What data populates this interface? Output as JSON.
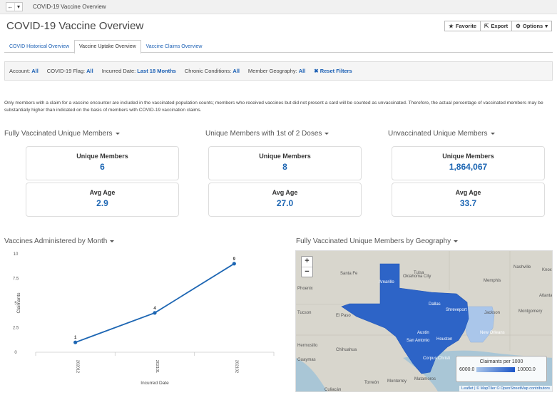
{
  "nav": {
    "back_glyph": "←",
    "menu_glyph": "▾",
    "breadcrumb": "COVID-19 Vaccine Overview"
  },
  "page": {
    "title": "COVID-19 Vaccine Overview"
  },
  "actions": {
    "favorite": {
      "icon": "star-icon",
      "glyph": "★",
      "label": "Favorite"
    },
    "export": {
      "icon": "export-icon",
      "glyph": "⇱",
      "label": "Export"
    },
    "options": {
      "icon": "gear-icon",
      "glyph": "⚙",
      "label": "Options",
      "caret": "▾"
    }
  },
  "tabs": [
    {
      "label": "COVID Historical Overview"
    },
    {
      "label": "Vaccine Uptake Overview"
    },
    {
      "label": "Vaccine Claims Overview"
    }
  ],
  "filters": {
    "items": [
      {
        "label": "Account:",
        "value": "All"
      },
      {
        "label": "COVID-19 Flag:",
        "value": "All"
      },
      {
        "label": "Incurred Date:",
        "value": "Last 18 Months"
      },
      {
        "label": "Chronic Conditions:",
        "value": "All"
      },
      {
        "label": "Member Geography:",
        "value": "All"
      }
    ],
    "reset_glyph": "✖",
    "reset_label": "Reset Filters"
  },
  "notice": "Only members with a claim for a vaccine encounter are included in the vaccinated population counts; members who received vaccines but did not present a card will be counted as unvaccinated. Therefore, the actual percentage of vaccinated members may be substantially higher than indicated on the basis of members with COVID-19 vaccination claims.",
  "metric_groups": [
    {
      "title": "Fully Vaccinated Unique Members",
      "cards": [
        {
          "label": "Unique Members",
          "value": "6"
        },
        {
          "label": "Avg Age",
          "value": "2.9"
        }
      ]
    },
    {
      "title": "Unique Members with 1st of 2 Doses",
      "cards": [
        {
          "label": "Unique Members",
          "value": "8"
        },
        {
          "label": "Avg Age",
          "value": "27.0"
        }
      ]
    },
    {
      "title": "Unvaccinated Unique Members",
      "cards": [
        {
          "label": "Unique Members",
          "value": "1,864,067"
        },
        {
          "label": "Avg Age",
          "value": "33.7"
        }
      ]
    }
  ],
  "vaccines_chart": {
    "title": "Vaccines Administered by Month"
  },
  "chart_data": {
    "type": "line",
    "title": "Vaccines Administered by Month",
    "categories": [
      "202012",
      "202101",
      "202102"
    ],
    "series": [
      {
        "values": [
          1,
          4,
          9
        ]
      }
    ],
    "data_labels": [
      "1",
      "4",
      "9"
    ],
    "xlabel": "Incurred Date",
    "ylabel": "Claimants",
    "ylim": [
      0,
      10
    ],
    "yticks": [
      "0",
      "2.5",
      "5",
      "7.5",
      "10"
    ],
    "grid": false,
    "color": "#1d66b3"
  },
  "map": {
    "title": "Fully Vaccinated Unique Members by Geography",
    "zoom_in": "+",
    "zoom_out": "−",
    "labels": [
      "Tulsa",
      "Oklahoma City",
      "Santa Fe",
      "Amarillo",
      "Memphis",
      "Nashville",
      "Knox",
      "Atlanta",
      "Tucson",
      "El Paso",
      "Dallas",
      "Shreveport",
      "Jackson",
      "Montgomery",
      "Austin",
      "San Antonio",
      "Houston",
      "New Orleans",
      "Chihuahua",
      "Hermosillo",
      "Guaymas",
      "Corpus Christi",
      "Torreón",
      "Monterrey",
      "Matamoros",
      "Culiacán",
      "Phoenix"
    ],
    "legend": {
      "title": "Claimants per 1000",
      "min": "6000.0",
      "max": "10000.0"
    },
    "attribution": "Leaflet | © MapTiler © OpenStreetMap contributors"
  }
}
